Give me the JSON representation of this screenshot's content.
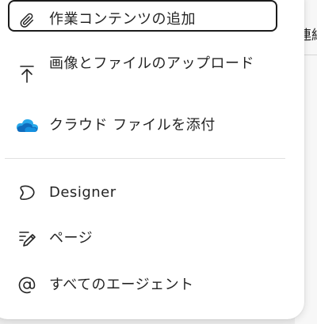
{
  "background": {
    "peek_text": "連絡"
  },
  "menu": {
    "items": [
      {
        "id": "add-work-content",
        "label": "作業コンテンツの追加",
        "icon": "paperclip-icon"
      },
      {
        "id": "upload-images-files",
        "label": "画像とファイルのアップロード",
        "icon": "upload-icon"
      },
      {
        "id": "attach-cloud-file",
        "label": "クラウド ファイルを添付",
        "icon": "onedrive-cloud-icon"
      },
      {
        "id": "designer",
        "label": "Designer",
        "icon": "designer-icon"
      },
      {
        "id": "pages",
        "label": "ページ",
        "icon": "page-edit-icon"
      },
      {
        "id": "all-agents",
        "label": "すべてのエージェント",
        "icon": "at-sign-icon"
      }
    ]
  },
  "colors": {
    "text": "#242424",
    "focus_border": "#1b1b1b",
    "cloud_blue": "#0f6cbd",
    "cloud_light": "#28a8ea"
  }
}
